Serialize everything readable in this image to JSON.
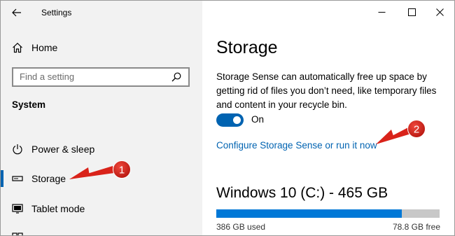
{
  "window": {
    "title": "Settings",
    "controls": {
      "minimize": "minimize-icon",
      "maximize": "maximize-icon",
      "close": "close-icon"
    }
  },
  "sidebar": {
    "home_label": "Home",
    "search_placeholder": "Find a setting",
    "section_title": "System",
    "items": [
      {
        "label": "Power & sleep",
        "icon": "power-icon"
      },
      {
        "label": "Storage",
        "icon": "storage-icon",
        "selected": true
      },
      {
        "label": "Tablet mode",
        "icon": "tablet-mode-icon"
      }
    ]
  },
  "main": {
    "title": "Storage",
    "description": "Storage Sense can automatically free up space by getting rid of files you don’t need, like temporary files and content in your recycle bin.",
    "toggle": {
      "state": "On",
      "on": true
    },
    "link": "Configure Storage Sense or run it now",
    "drive": {
      "title": "Windows 10 (C:) - 465 GB",
      "used": "386 GB used",
      "free": "78.8 GB free",
      "used_fraction": 0.83
    }
  },
  "annotations": [
    {
      "number": "1",
      "target": "Storage"
    },
    {
      "number": "2",
      "target": "Configure Storage Sense or run it now"
    }
  ],
  "colors": {
    "accent": "#0063b1",
    "annotation_red": "#d9231a",
    "sidebar_bg": "#f2f2f2"
  }
}
